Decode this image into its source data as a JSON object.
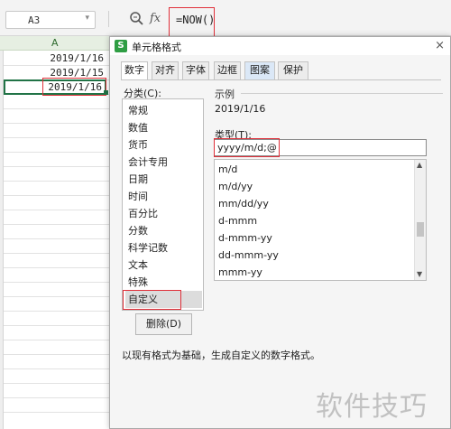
{
  "toolbar": {
    "name_box_value": "A3",
    "fx_label": "fx",
    "formula_value": "=NOW()"
  },
  "sheet": {
    "column_header": "A",
    "cells": [
      "2019/1/16",
      "2019/1/15",
      "2019/1/16"
    ],
    "selected_cell_index": 2
  },
  "dialog": {
    "title": "单元格格式",
    "app_icon_letter": "S",
    "close_glyph": "×",
    "tabs": [
      {
        "label": "数字",
        "active": true
      },
      {
        "label": "对齐",
        "active": false
      },
      {
        "label": "字体",
        "active": false
      },
      {
        "label": "边框",
        "active": false
      },
      {
        "label": "图案",
        "active": false
      },
      {
        "label": "保护",
        "active": false
      }
    ],
    "category_label": "分类(C):",
    "categories": [
      "常规",
      "数值",
      "货币",
      "会计专用",
      "日期",
      "时间",
      "百分比",
      "分数",
      "科学记数",
      "文本",
      "特殊",
      "自定义"
    ],
    "selected_category": "自定义",
    "sample_label": "示例",
    "sample_value": "2019/1/16",
    "type_label": "类型(T):",
    "type_value": "yyyy/m/d;@",
    "format_list": [
      "m/d",
      "m/d/yy",
      "mm/dd/yy",
      "d-mmm",
      "d-mmm-yy",
      "dd-mmm-yy",
      "mmm-yy"
    ],
    "delete_button": "删除(D)",
    "description": "以现有格式为基础，生成自定义的数字格式。"
  },
  "watermark": "软件技巧",
  "colors": {
    "highlight_red": "#e0303a",
    "selection_green": "#217346",
    "app_icon_green": "#2f9e44"
  },
  "icons": {
    "zoom": "magnifier-icon",
    "close": "close-icon",
    "dropdown": "chevron-down-icon"
  }
}
